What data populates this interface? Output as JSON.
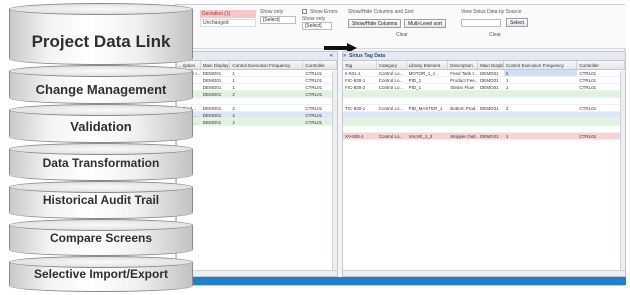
{
  "toolbar": {
    "status_changed": "Deviation (1)",
    "status_unchanged": "Unchanged",
    "show_only_label_1": "Show only",
    "select_1": "[Select]",
    "show_errors": "Show Errors",
    "show_only_label_2": "Show only",
    "select_2": "[Select]",
    "columns_sort_label": "Show/Hide Columns and Sort",
    "show_hide_columns_btn": "Show/Hide Columns",
    "multi_level_sort_btn": "Multi-Level sort",
    "clear_1": "Clear",
    "view_source_label": "View Sirius Data by Source",
    "select_btn": "Select",
    "clear_2": "Clear"
  },
  "left_grid": {
    "headers": [
      "...ription",
      "Main Display",
      "Control Execution Frequency",
      "Controller"
    ],
    "rows": [
      {
        "style": "",
        "cells": [
          "Sample t...",
          "DEMO01",
          "1",
          "CTRL01"
        ]
      },
      {
        "style": "",
        "cells": [
          "...Flow",
          "DEMO01",
          "1",
          "CTRL01"
        ]
      },
      {
        "style": "",
        "cells": [
          "...Flow",
          "DEMO01",
          "1",
          "CTRL01"
        ]
      },
      {
        "style": "green",
        "cells": [
          "...ht",
          "DEMO01",
          "2",
          "CTRL01"
        ]
      },
      {
        "style": "",
        "cells": [
          "...Prod...",
          "DEMO01",
          "2",
          "CTRL01"
        ]
      },
      {
        "style": "blue",
        "cells": [
          "...Prod...",
          "DEMO01",
          "2",
          "CTRL01"
        ]
      },
      {
        "style": "green",
        "cells": [
          "...Strip...",
          "DEMO01",
          "2",
          "CTRL01"
        ]
      }
    ]
  },
  "right_grid": {
    "title": "Sirius Tag Data",
    "headers": [
      "Tag",
      "Category",
      "Library Element",
      "Description",
      "Main Display",
      "Control Execution Frequency",
      "Controller"
    ],
    "rows": [
      {
        "style": "",
        "cells": [
          "II-831-1",
          "Control Lo...",
          "MOTOR_1_1",
          "Feed Tank t...",
          "DEMO01",
          "2",
          "CTRL01"
        ]
      },
      {
        "style": "",
        "cells": [
          "FIC-830-1",
          "Control Lo...",
          "PID_1",
          "Product Fee...",
          "DEMO01",
          "1",
          "CTRL01"
        ]
      },
      {
        "style": "",
        "cells": [
          "FIC-830-2",
          "Control Lo...",
          "PID_1",
          "Steam Flow",
          "DEMO01",
          "1",
          "CTRL01"
        ]
      },
      {
        "style": "green",
        "cells": [
          "",
          "",
          "",
          "",
          "",
          "",
          ""
        ]
      },
      {
        "style": "",
        "cells": [
          "TIC-830-1",
          "Control Lo...",
          "PID_MASTER_1",
          "Bottom Prod...",
          "DEMO01",
          "2",
          "CTRL01"
        ]
      },
      {
        "style": "blue",
        "cells": [
          "",
          "",
          "",
          "",
          "",
          "",
          ""
        ]
      },
      {
        "style": "green",
        "cells": [
          "",
          "",
          "",
          "",
          "",
          "",
          ""
        ]
      },
      {
        "style": "pink",
        "cells": [
          "XV-830-1",
          "Control Lo...",
          "VALVE_1_2",
          "Stripper Outl...",
          "DEMO01",
          "1",
          "CTRL01"
        ]
      }
    ]
  },
  "stack": [
    "Project Data Link",
    "Change Management",
    "Validation",
    "Data Transformation",
    "Historical Audit Trail",
    "Compare Screens",
    "Selective Import/Export"
  ]
}
